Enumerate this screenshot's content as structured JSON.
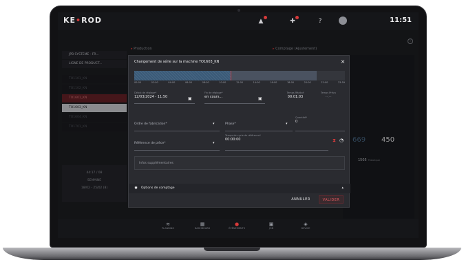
{
  "app": {
    "logo_text": "KE",
    "logo_suffix": "ROD",
    "clock": "11:51"
  },
  "sidebar": {
    "cards": [
      {
        "label": "JPB SYSTEME - FR..."
      },
      {
        "label": "LIGNE DE PRODUCT..."
      }
    ],
    "machines": [
      {
        "label": "TO1101_KN",
        "state": "normal"
      },
      {
        "label": "TO1102_KN",
        "state": "normal"
      },
      {
        "label": "TO1601_KN",
        "state": "red"
      },
      {
        "label": "TO1603_KN",
        "state": "active"
      },
      {
        "label": "TO1604_KN",
        "state": "normal"
      },
      {
        "label": "TO1701_KN",
        "state": "normal"
      }
    ],
    "bottom": {
      "line1": "44:17 / 08",
      "line2": "SEMAINE",
      "line3": "18/02 - 25/02 (8)"
    }
  },
  "sections": {
    "production": "Production",
    "comptage": "Comptage (Ajustement)"
  },
  "right_panel": {
    "value_a": "669",
    "value_b": "450",
    "value_c": "1505",
    "label_c": "Theorique"
  },
  "nav": {
    "items": [
      {
        "label": "PLANNING"
      },
      {
        "label": "DASHBOARD"
      },
      {
        "label": "ÉVÉNEMENTS"
      },
      {
        "label": "JOB"
      },
      {
        "label": "DEVICE"
      }
    ]
  },
  "modal": {
    "title": "Changement de série sur la machine TO1603_KN",
    "close": "×",
    "timeline_ticks": [
      "00:00",
      "02:00",
      "04:00",
      "06:00",
      "08:00",
      "10:00",
      "12:00",
      "14:00",
      "16:00",
      "18:00",
      "20:00",
      "22:00",
      "23:59"
    ],
    "start": {
      "label": "Début de réglage*",
      "value": "12/03/2024 - 11:50"
    },
    "end": {
      "label": "Fin de réglage*",
      "value": "en cours..."
    },
    "elapsed": {
      "label": "Temps Réalisé",
      "value": "00:01:03"
    },
    "planned": {
      "label": "Temps Prévu",
      "value": "--:--"
    },
    "order": {
      "label": "Ordre de fabrication*"
    },
    "phase": {
      "label": "Phase*"
    },
    "qty": {
      "label": "Quantité*",
      "value": "0"
    },
    "reference": {
      "label": "Référence de pièce*"
    },
    "cycle": {
      "label": "Temps de cycle de référence*",
      "value": "00:00:00"
    },
    "notes": {
      "placeholder": "Infos supplémentaires"
    },
    "options_label": "Options de comptage",
    "cancel": "ANNULER",
    "validate": "VALIDER"
  }
}
